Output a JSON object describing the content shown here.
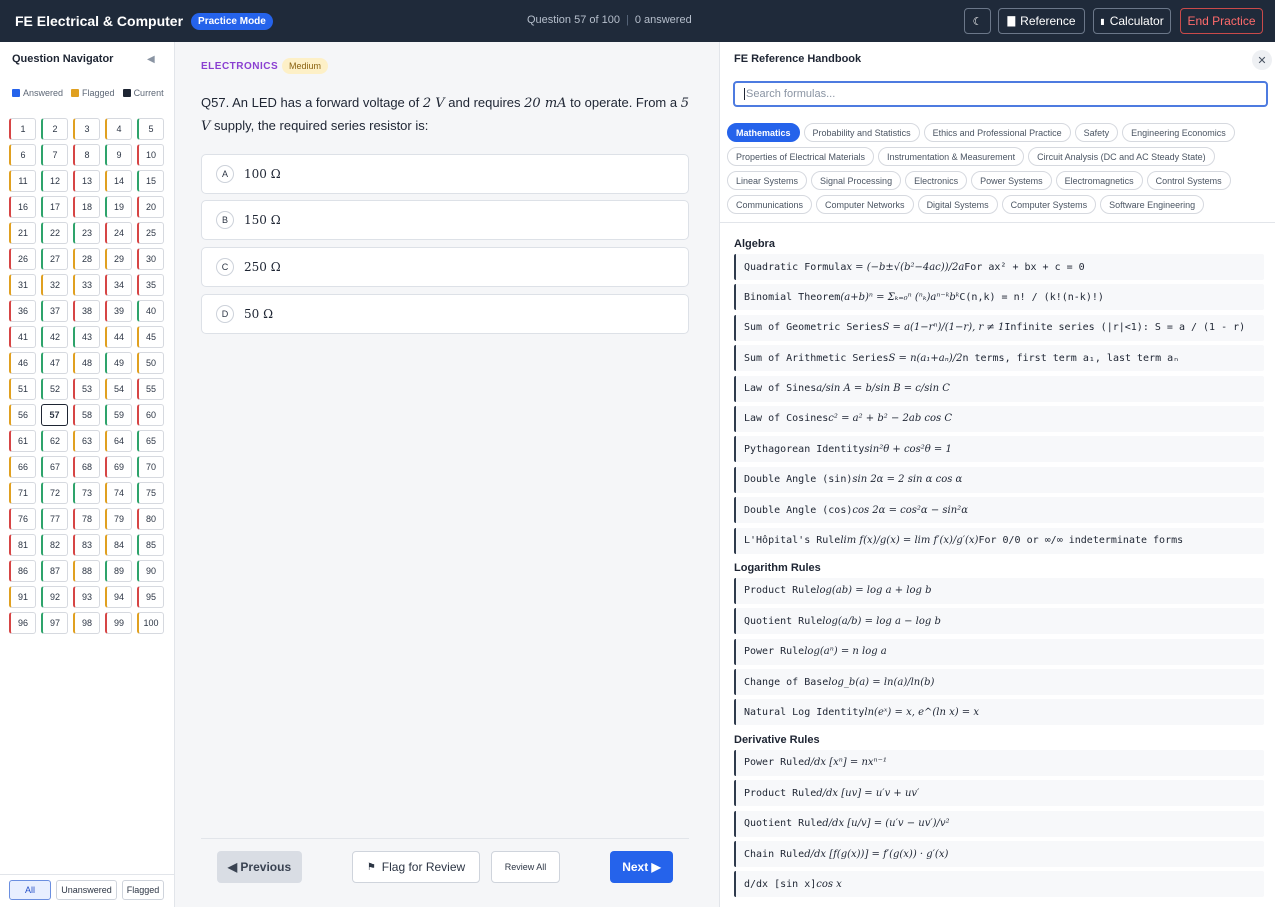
{
  "header": {
    "title": "FE Electrical & Computer",
    "mode_badge": "Practice Mode",
    "question_counter": "Question 57 of 100",
    "answered_counter": "0 answered",
    "theme_icon": "moon-icon",
    "reference_label": "Reference",
    "calculator_label": "Calculator",
    "end_label": "End Practice"
  },
  "navigator": {
    "title": "Question Navigator",
    "legend": {
      "answered": "Answered",
      "flagged": "Flagged",
      "current": "Current"
    },
    "legend_colors": {
      "answered": "#2563eb",
      "flagged": "#e0a020",
      "current": "#1e2533"
    },
    "current_question": 57,
    "cells": [
      {
        "n": "1",
        "c": "red"
      },
      {
        "n": "2",
        "c": "green"
      },
      {
        "n": "3",
        "c": "orange"
      },
      {
        "n": "4",
        "c": "orange"
      },
      {
        "n": "5",
        "c": "green"
      },
      {
        "n": "6",
        "c": "orange"
      },
      {
        "n": "7",
        "c": "green"
      },
      {
        "n": "8",
        "c": "red"
      },
      {
        "n": "9",
        "c": "green"
      },
      {
        "n": "10",
        "c": "red"
      },
      {
        "n": "11",
        "c": "orange"
      },
      {
        "n": "12",
        "c": "green"
      },
      {
        "n": "13",
        "c": "red"
      },
      {
        "n": "14",
        "c": "orange"
      },
      {
        "n": "15",
        "c": "green"
      },
      {
        "n": "16",
        "c": "red"
      },
      {
        "n": "17",
        "c": "green"
      },
      {
        "n": "18",
        "c": "red"
      },
      {
        "n": "19",
        "c": "green"
      },
      {
        "n": "20",
        "c": "red"
      },
      {
        "n": "21",
        "c": "orange"
      },
      {
        "n": "22",
        "c": "green"
      },
      {
        "n": "23",
        "c": "green"
      },
      {
        "n": "24",
        "c": "red"
      },
      {
        "n": "25",
        "c": "red"
      },
      {
        "n": "26",
        "c": "red"
      },
      {
        "n": "27",
        "c": "green"
      },
      {
        "n": "28",
        "c": "orange"
      },
      {
        "n": "29",
        "c": "orange"
      },
      {
        "n": "30",
        "c": "red"
      },
      {
        "n": "31",
        "c": "orange"
      },
      {
        "n": "32",
        "c": "orange"
      },
      {
        "n": "33",
        "c": "orange"
      },
      {
        "n": "34",
        "c": "red"
      },
      {
        "n": "35",
        "c": "red"
      },
      {
        "n": "36",
        "c": "red"
      },
      {
        "n": "37",
        "c": "green"
      },
      {
        "n": "38",
        "c": "red"
      },
      {
        "n": "39",
        "c": "red"
      },
      {
        "n": "40",
        "c": "green"
      },
      {
        "n": "41",
        "c": "red"
      },
      {
        "n": "42",
        "c": "green"
      },
      {
        "n": "43",
        "c": "green"
      },
      {
        "n": "44",
        "c": "orange"
      },
      {
        "n": "45",
        "c": "orange"
      },
      {
        "n": "46",
        "c": "orange"
      },
      {
        "n": "47",
        "c": "green"
      },
      {
        "n": "48",
        "c": "orange"
      },
      {
        "n": "49",
        "c": "green"
      },
      {
        "n": "50",
        "c": "orange"
      },
      {
        "n": "51",
        "c": "orange"
      },
      {
        "n": "52",
        "c": "green"
      },
      {
        "n": "53",
        "c": "red"
      },
      {
        "n": "54",
        "c": "orange"
      },
      {
        "n": "55",
        "c": "red"
      },
      {
        "n": "56",
        "c": "orange"
      },
      {
        "n": "57",
        "c": "current"
      },
      {
        "n": "58",
        "c": "red"
      },
      {
        "n": "59",
        "c": "green"
      },
      {
        "n": "60",
        "c": "red"
      },
      {
        "n": "61",
        "c": "red"
      },
      {
        "n": "62",
        "c": "green"
      },
      {
        "n": "63",
        "c": "orange"
      },
      {
        "n": "64",
        "c": "orange"
      },
      {
        "n": "65",
        "c": "green"
      },
      {
        "n": "66",
        "c": "orange"
      },
      {
        "n": "67",
        "c": "green"
      },
      {
        "n": "68",
        "c": "red"
      },
      {
        "n": "69",
        "c": "red"
      },
      {
        "n": "70",
        "c": "green"
      },
      {
        "n": "71",
        "c": "orange"
      },
      {
        "n": "72",
        "c": "green"
      },
      {
        "n": "73",
        "c": "green"
      },
      {
        "n": "74",
        "c": "orange"
      },
      {
        "n": "75",
        "c": "green"
      },
      {
        "n": "76",
        "c": "red"
      },
      {
        "n": "77",
        "c": "green"
      },
      {
        "n": "78",
        "c": "red"
      },
      {
        "n": "79",
        "c": "orange"
      },
      {
        "n": "80",
        "c": "red"
      },
      {
        "n": "81",
        "c": "red"
      },
      {
        "n": "82",
        "c": "green"
      },
      {
        "n": "83",
        "c": "red"
      },
      {
        "n": "84",
        "c": "orange"
      },
      {
        "n": "85",
        "c": "green"
      },
      {
        "n": "86",
        "c": "red"
      },
      {
        "n": "87",
        "c": "green"
      },
      {
        "n": "88",
        "c": "orange"
      },
      {
        "n": "89",
        "c": "green"
      },
      {
        "n": "90",
        "c": "green"
      },
      {
        "n": "91",
        "c": "orange"
      },
      {
        "n": "92",
        "c": "green"
      },
      {
        "n": "93",
        "c": "red"
      },
      {
        "n": "94",
        "c": "orange"
      },
      {
        "n": "95",
        "c": "red"
      },
      {
        "n": "96",
        "c": "red"
      },
      {
        "n": "97",
        "c": "green"
      },
      {
        "n": "98",
        "c": "orange"
      },
      {
        "n": "99",
        "c": "red"
      },
      {
        "n": "100",
        "c": "orange"
      }
    ],
    "filters": [
      "All",
      "Unanswered",
      "Flagged"
    ],
    "active_filter": "All"
  },
  "question": {
    "category": "ELECTRONICS",
    "difficulty": "Medium",
    "text_prefix": "Q57. An LED has a forward voltage of ",
    "v1": "2 V",
    "text_mid": " and requires ",
    "i1": "20 mA",
    "text_mid2": " to operate. From a ",
    "v2": "5 V",
    "text_suffix": " supply, the required series resistor is:",
    "options": [
      {
        "letter": "A",
        "value": "100 Ω"
      },
      {
        "letter": "B",
        "value": "150 Ω"
      },
      {
        "letter": "C",
        "value": "250 Ω"
      },
      {
        "letter": "D",
        "value": "50 Ω"
      }
    ],
    "prev_label": "◀ Previous",
    "flag_label": "Flag for Review",
    "review_label": "Review All",
    "next_label": "Next ▶"
  },
  "reference": {
    "title": "FE Reference Handbook",
    "search_placeholder": "Search formulas...",
    "tabs": [
      "Mathematics",
      "Probability and Statistics",
      "Ethics and Professional Practice",
      "Safety",
      "Engineering Economics",
      "Properties of Electrical Materials",
      "Instrumentation & Measurement",
      "Circuit Analysis (DC and AC Steady State)",
      "Linear Systems",
      "Signal Processing",
      "Electronics",
      "Power Systems",
      "Electromagnetics",
      "Control Systems",
      "Communications",
      "Computer Networks",
      "Digital Systems",
      "Computer Systems",
      "Software Engineering"
    ],
    "active_tab": "Mathematics",
    "sections": [
      {
        "title": "Algebra",
        "formulas": [
          {
            "name": "Quadratic Formula",
            "expr": "x = (−b±√(b²−4ac))/2a",
            "note": "For ax² + bx + c = 0"
          },
          {
            "name": "Binomial Theorem",
            "expr": "(a+b)ⁿ = Σₖ₌₀ⁿ (ⁿₖ)aⁿ⁻ᵏbᵏ",
            "note": "C(n,k) = n! / (k!(n-k)!)"
          },
          {
            "name": "Sum of Geometric Series",
            "expr": "S = a(1−rⁿ)/(1−r), r ≠ 1",
            "note": "Infinite series (|r|<1): S = a / (1 - r)"
          },
          {
            "name": "Sum of Arithmetic Series",
            "expr": "S = n(a₁+aₙ)/2",
            "note": "n terms, first term a₁, last term aₙ"
          },
          {
            "name": "Law of Sines",
            "expr": "a/sin A = b/sin B = c/sin C",
            "note": ""
          },
          {
            "name": "Law of Cosines",
            "expr": "c² = a² + b² − 2ab cos C",
            "note": ""
          },
          {
            "name": "Pythagorean Identity",
            "expr": "sin²θ + cos²θ = 1",
            "note": ""
          },
          {
            "name": "Double Angle (sin)",
            "expr": "sin 2α = 2 sin α cos α",
            "note": ""
          },
          {
            "name": "Double Angle (cos)",
            "expr": "cos 2α = cos²α − sin²α",
            "note": ""
          },
          {
            "name": "L'Hôpital's Rule",
            "expr": "lim f(x)/g(x) = lim f′(x)/g′(x)",
            "note": "For 0/0 or ∞/∞ indeterminate forms"
          }
        ]
      },
      {
        "title": "Logarithm Rules",
        "formulas": [
          {
            "name": "Product Rule",
            "expr": "log(ab) = log a + log b",
            "note": ""
          },
          {
            "name": "Quotient Rule",
            "expr": "log(a/b) = log a − log b",
            "note": ""
          },
          {
            "name": "Power Rule",
            "expr": "log(aⁿ) = n log a",
            "note": ""
          },
          {
            "name": "Change of Base",
            "expr": "log_b(a) = ln(a)/ln(b)",
            "note": ""
          },
          {
            "name": "Natural Log Identity",
            "expr": "ln(eˣ) = x,   e^(ln x) = x",
            "note": ""
          }
        ]
      },
      {
        "title": "Derivative Rules",
        "formulas": [
          {
            "name": "Power Rule",
            "expr": "d/dx [xⁿ] = nxⁿ⁻¹",
            "note": ""
          },
          {
            "name": "Product Rule",
            "expr": "d/dx [uv] = u′v + uv′",
            "note": ""
          },
          {
            "name": "Quotient Rule",
            "expr": "d/dx [u/v] = (u′v − uv′)/v²",
            "note": ""
          },
          {
            "name": "Chain Rule",
            "expr": "d/dx [f(g(x))] = f′(g(x)) · g′(x)",
            "note": ""
          },
          {
            "name": "d/dx [sin x]",
            "expr": "cos x",
            "note": ""
          }
        ]
      }
    ]
  }
}
